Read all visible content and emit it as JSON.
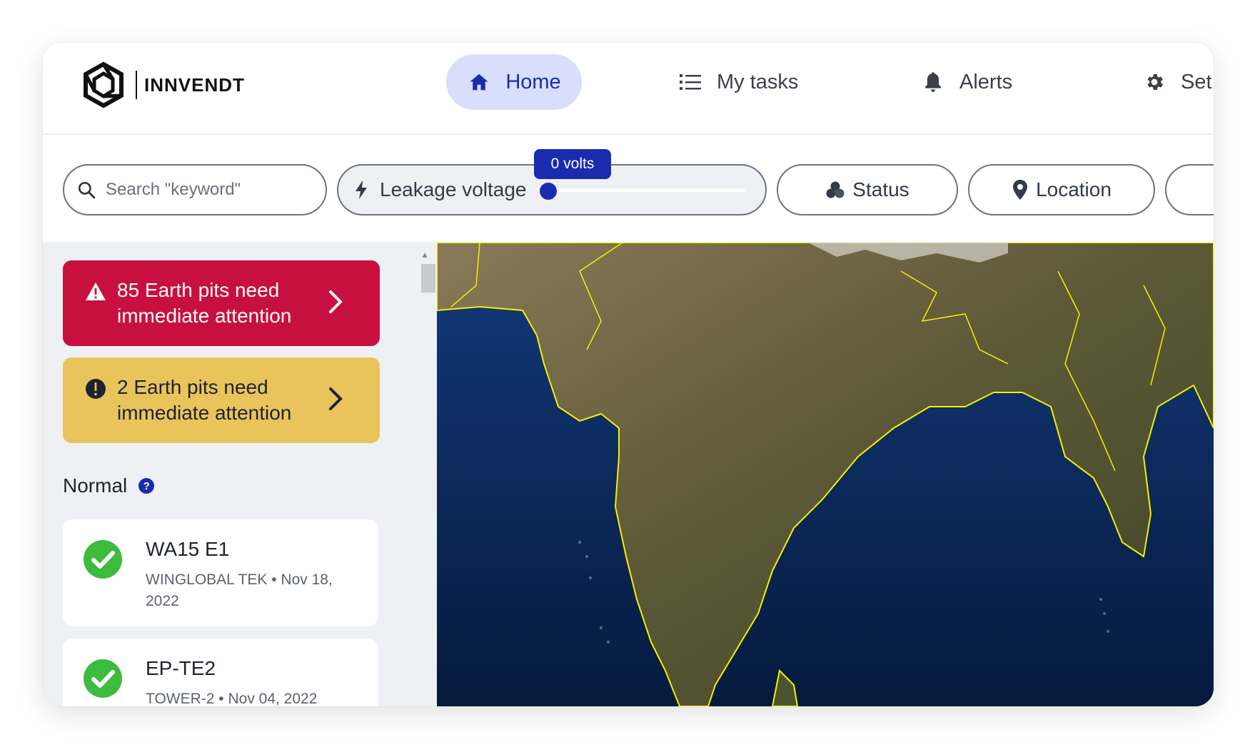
{
  "brand": {
    "name": "INNVENDT",
    "logo_icon": "hexagon-shutter-icon"
  },
  "nav": {
    "items": [
      {
        "label": "Home",
        "icon": "home-icon",
        "active": true
      },
      {
        "label": "My tasks",
        "icon": "list-icon"
      },
      {
        "label": "Alerts",
        "icon": "bell-icon"
      },
      {
        "label": "Set",
        "icon": "gear-icon"
      }
    ]
  },
  "filters": {
    "search_placeholder": "Search \"keyword\"",
    "voltage": {
      "label": "Leakage voltage",
      "tooltip": "0 volts",
      "value": 0
    },
    "status_label": "Status",
    "location_label": "Location"
  },
  "alerts": [
    {
      "text": "85 Earth pits need immediate attention",
      "color": "#c8103e",
      "icon": "warning-triangle-icon"
    },
    {
      "text": "2 Earth pits need immediate attention",
      "color": "#e9c45a",
      "icon": "exclamation-circle-icon"
    }
  ],
  "normal": {
    "title": "Normal",
    "help_icon": "?",
    "items": [
      {
        "name": "WA15 E1",
        "meta": "WINGLOBAL TEK • Nov 18, 2022",
        "status_icon": "check-circle-icon"
      },
      {
        "name": "EP-TE2",
        "meta": "TOWER-2 • Nov 04, 2022",
        "status_icon": "check-circle-icon"
      }
    ]
  },
  "colors": {
    "accent": "#1b2bb0",
    "accent_light": "#d9defa",
    "ok_green": "#3dbb3d",
    "border_yellow": "#f5f000"
  }
}
